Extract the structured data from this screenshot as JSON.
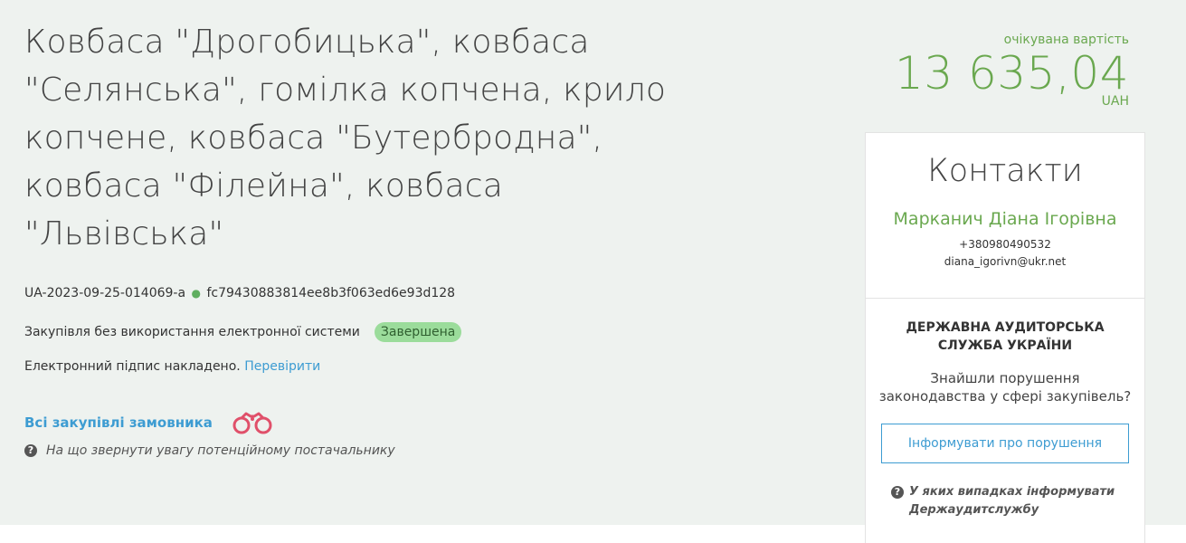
{
  "tender": {
    "title": "Ковбаса \"Дрогобицька\", ковбаса \"Селянська\", гомілка копчена, крило копчене, ковбаса \"Бутербродна\", ковбаса \"Філейна\", ковбаса \"Львівська\"",
    "id": "UA-2023-09-25-014069-a",
    "hash": "fc79430883814ee8b3f063ed6e93d128",
    "method": "Закупівля без використання електронної системи",
    "status": "Завершена",
    "signature_text": "Електронний підпис накладено.",
    "signature_link": "Перевірити",
    "all_purchases_link": "Всі закупівлі замовника",
    "supplier_hint": "На що звернути увагу потенційному постачальнику"
  },
  "price": {
    "label": "очікувана вартість",
    "value": "13 635,04",
    "currency": "UAH"
  },
  "contacts": {
    "title": "Контакти",
    "name": "Марканич Діана Ігорівна",
    "phone": "+380980490532",
    "email": "diana_igorivn@ukr.net"
  },
  "audit": {
    "title": "ДЕРЖАВНА АУДИТОРСЬКА СЛУЖБА УКРАЇНИ",
    "text": "Знайшли порушення законодавства у сфері закупівель?",
    "button": "Інформувати про порушення",
    "hint": "У яких випадках інформувати Держаудитслужбу"
  },
  "icons": {
    "binoculars": "binoculars-icon",
    "question": "question-circle-icon"
  },
  "colors": {
    "accent_green": "#6aa84f",
    "link_blue": "#3d9cd2",
    "badge_green": "#9bdc9b",
    "hero_background": "#eef2ef"
  }
}
